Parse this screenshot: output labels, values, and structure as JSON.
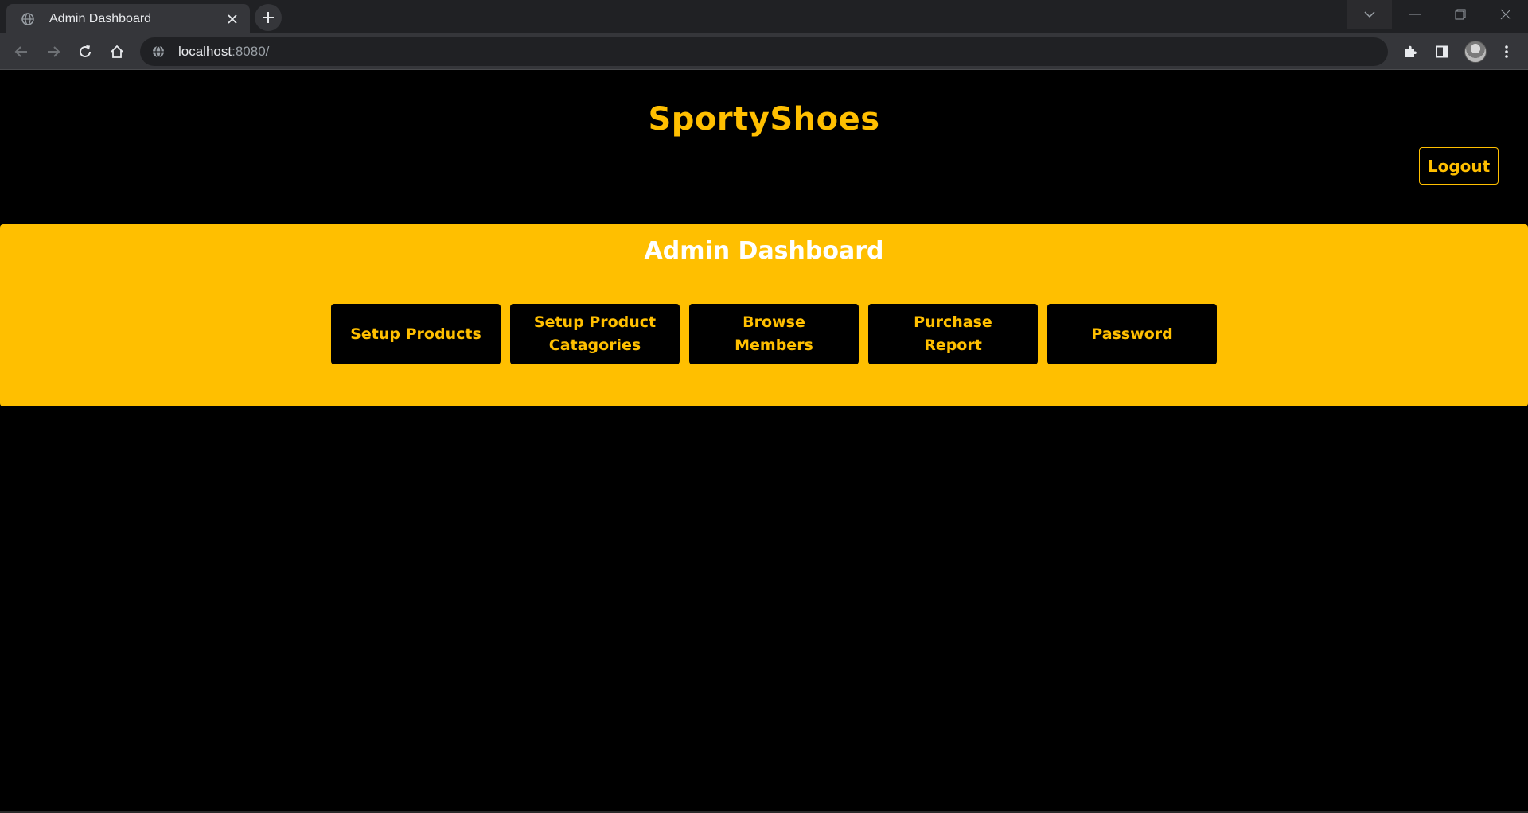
{
  "browser": {
    "tab": {
      "title": "Admin Dashboard"
    },
    "address": {
      "host": "localhost",
      "rest": ":8080/"
    }
  },
  "page": {
    "brand": "SportyShoes",
    "logout_label": "Logout",
    "dashboard_title": "Admin Dashboard",
    "actions": [
      {
        "label": "Setup Products"
      },
      {
        "label": "Setup Product Catagories"
      },
      {
        "label": "Browse Members"
      },
      {
        "label": "Purchase Report"
      },
      {
        "label": "Password"
      }
    ]
  },
  "colors": {
    "accent": "#ffbf00",
    "background": "#000000",
    "panel_title": "#ffffff"
  }
}
